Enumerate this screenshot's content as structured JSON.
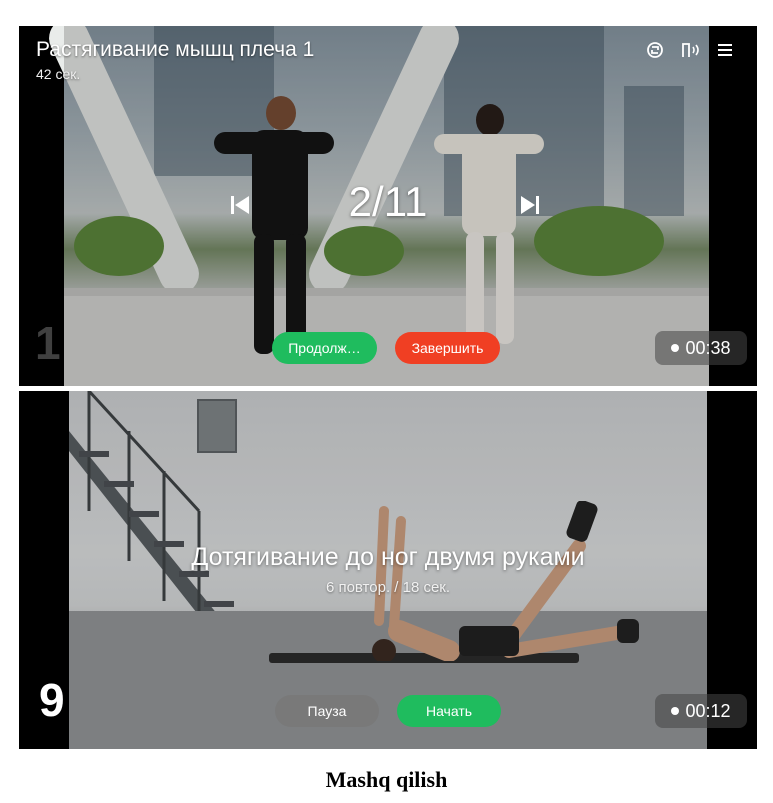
{
  "panel1": {
    "title": "Растягивание мышц плеча 1",
    "duration": "42 сек.",
    "counter": "2/11",
    "index": "1",
    "continue_label": "Продолж…",
    "finish_label": "Завершить",
    "timer": "00:38",
    "icons": [
      "rotate-icon",
      "audio-guide-icon",
      "menu-icon"
    ]
  },
  "panel2": {
    "exercise_name": "Дотягивание до ног двумя руками",
    "details": "6 повтор. / 18 сек.",
    "index": "9",
    "pause_label": "Пауза",
    "start_label": "Начать",
    "timer": "00:12"
  },
  "caption": "Mashq qilish",
  "colors": {
    "green": "#1fbc5e",
    "red": "#f03f23",
    "gray": "#7a7a7a"
  }
}
